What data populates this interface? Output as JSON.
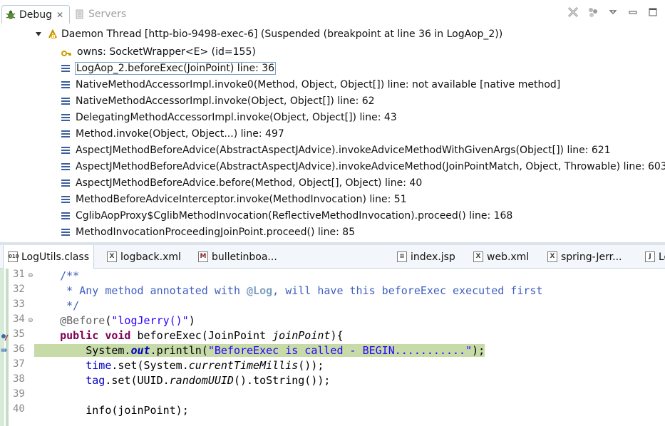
{
  "debug_view": {
    "tabs": {
      "debug_label": "Debug",
      "servers_label": "Servers"
    },
    "thread_label": "Daemon Thread [http-bio-9498-exec-6] (Suspended (breakpoint at line 36 in LogAop_2))",
    "owns_label": "owns: SocketWrapper<E>  (id=155)",
    "frames": [
      "LogAop_2.beforeExec(JoinPoint) line: 36",
      "NativeMethodAccessorImpl.invoke0(Method, Object, Object[]) line: not available [native method]",
      "NativeMethodAccessorImpl.invoke(Object, Object[]) line: 62",
      "DelegatingMethodAccessorImpl.invoke(Object, Object[]) line: 43",
      "Method.invoke(Object, Object...) line: 497",
      "AspectJMethodBeforeAdvice(AbstractAspectJAdvice).invokeAdviceMethodWithGivenArgs(Object[]) line: 621",
      "AspectJMethodBeforeAdvice(AbstractAspectJAdvice).invokeAdviceMethod(JoinPointMatch, Object, Throwable) line: 603",
      "AspectJMethodBeforeAdvice.before(Method, Object[], Object) line: 40",
      "MethodBeforeAdviceInterceptor.invoke(MethodInvocation) line: 51",
      "CglibAopProxy$CglibMethodInvocation(ReflectiveMethodInvocation).proceed() line: 168",
      "MethodInvocationProceedingJoinPoint.proceed() line: 85"
    ]
  },
  "editor": {
    "tabs": [
      {
        "label": "LogUtils.class",
        "icon": "class-file-icon"
      },
      {
        "label": "logback.xml",
        "icon": "xml-file-icon"
      },
      {
        "label": "bulletinboa...",
        "icon": "mapper-file-icon"
      },
      {
        "label": "index.jsp",
        "icon": "jsp-file-icon"
      },
      {
        "label": "web.xml",
        "icon": "xml-file-icon"
      },
      {
        "label": "spring-Jerr...",
        "icon": "xml-file-icon"
      },
      {
        "label": "Lo",
        "icon": "java-file-icon"
      }
    ],
    "line_numbers": [
      "31",
      "32",
      "33",
      "34",
      "35",
      "36",
      "37",
      "38",
      "39",
      "40"
    ],
    "code": {
      "l31": "/**",
      "l32_a": " * Any method annotated with ",
      "l32_b": "@Log",
      "l32_c": ", will have this beforeExec executed first",
      "l33": " */",
      "l34_a": "@Before",
      "l34_b": "(",
      "l34_c": "\"logJerry()\"",
      "l34_d": ")",
      "l35_a": "public void",
      "l35_b": " beforeExec(JoinPoint ",
      "l35_c": "joinPoint",
      "l35_d": "){",
      "l36_a": "    System.",
      "l36_b": "out",
      "l36_c": ".println(",
      "l36_d": "\"BeforeExec is called - BEGIN...........\"",
      "l36_e": ");",
      "l37_a": "    ",
      "l37_b": "time",
      "l37_c": ".set(System.",
      "l37_d": "currentTimeMillis",
      "l37_e": "());",
      "l38_a": "    ",
      "l38_b": "tag",
      "l38_c": ".set(UUID.",
      "l38_d": "randomUUID",
      "l38_e": "().toString());",
      "l40": "    info(joinPoint);"
    }
  }
}
